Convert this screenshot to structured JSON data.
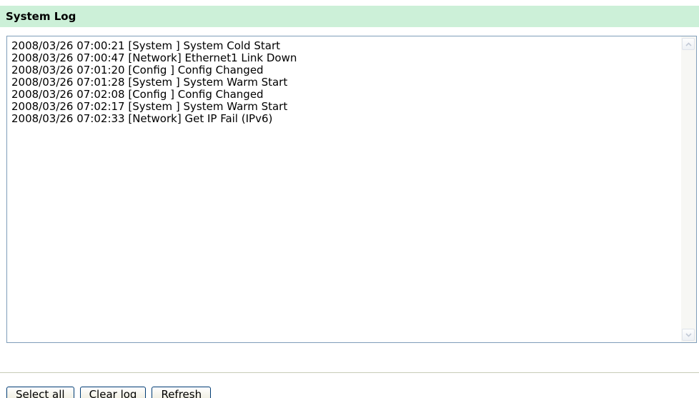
{
  "header": {
    "title": "System Log"
  },
  "log": {
    "content": "2008/03/26 07:00:21 [System ] System Cold Start\n2008/03/26 07:00:47 [Network] Ethernet1 Link Down\n2008/03/26 07:01:20 [Config ] Config Changed\n2008/03/26 07:01:28 [System ] System Warm Start\n2008/03/26 07:02:08 [Config ] Config Changed\n2008/03/26 07:02:17 [System ] System Warm Start\n2008/03/26 07:02:33 [Network] Get IP Fail (IPv6)",
    "scroll_up_icon": "chevron-up-icon",
    "scroll_down_icon": "chevron-down-icon"
  },
  "buttons": {
    "select_all": "Select all",
    "clear_log": "Clear log",
    "refresh": "Refresh"
  },
  "colors": {
    "title_bar": "#ccf0d8",
    "border": "#7f9db9"
  }
}
